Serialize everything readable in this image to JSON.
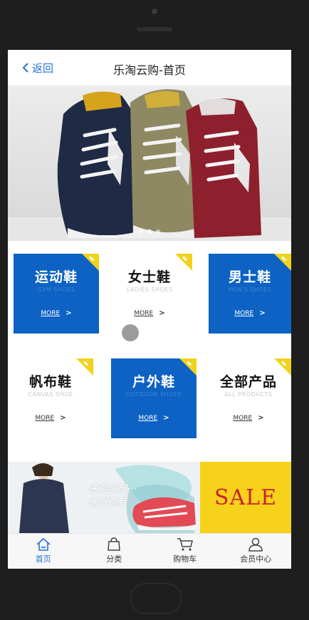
{
  "header": {
    "back_label": "返回",
    "title": "乐淘云购-首页"
  },
  "banner": {
    "slide_count": 3,
    "active_slide": 1
  },
  "categories": [
    {
      "title": "运动鞋",
      "subtitle": "GYM SHOES",
      "more": "MORE",
      "style": "blue"
    },
    {
      "title": "女士鞋",
      "subtitle": "LADIES SHOES",
      "more": "MORE",
      "style": "white"
    },
    {
      "title": "男士鞋",
      "subtitle": "MEN'S SHOES",
      "more": "MORE",
      "style": "blue"
    },
    {
      "title": "帆布鞋",
      "subtitle": "CANVAS SHOE",
      "more": "MORE",
      "style": "white"
    },
    {
      "title": "户外鞋",
      "subtitle": "OUTDOOR SHOES",
      "more": "MORE",
      "style": "blue"
    },
    {
      "title": "全部产品",
      "subtitle": "ALL PRODUCTS",
      "more": "MORE",
      "style": "white"
    }
  ],
  "promo": {
    "line1": "送羽绒服···",
    "line2": "送慢跑鞋",
    "sale": "SALE"
  },
  "tabbar": [
    {
      "label": "首页",
      "icon": "home-icon",
      "active": true
    },
    {
      "label": "分类",
      "icon": "bag-icon",
      "active": false
    },
    {
      "label": "购物车",
      "icon": "cart-icon",
      "active": false
    },
    {
      "label": "会员中心",
      "icon": "user-icon",
      "active": false
    }
  ],
  "colors": {
    "accent": "#2a72d6",
    "tile_blue": "#0d62c3",
    "corner_yellow": "#f2d21b",
    "sale_bg": "#f7d21a",
    "sale_text": "#c8232c"
  }
}
